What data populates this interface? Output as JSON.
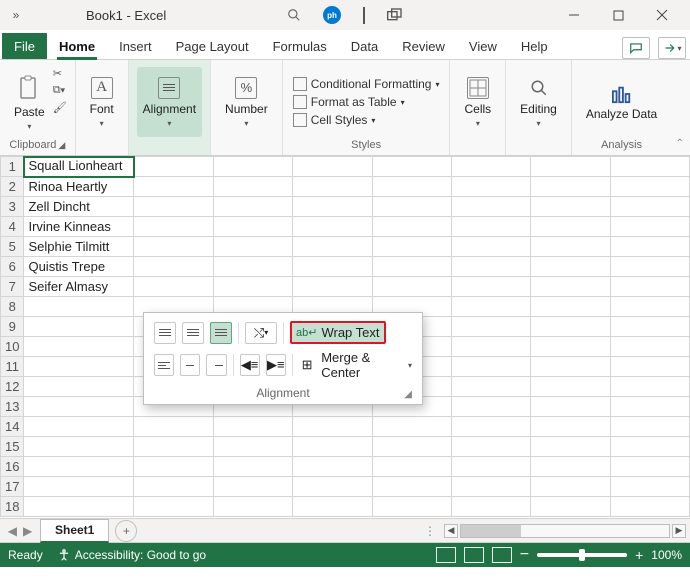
{
  "title": "Book1 - Excel",
  "tabs": {
    "file": "File",
    "home": "Home",
    "insert": "Insert",
    "page_layout": "Page Layout",
    "formulas": "Formulas",
    "data": "Data",
    "review": "Review",
    "view": "View",
    "help": "Help"
  },
  "ribbon": {
    "clipboard": {
      "paste": "Paste",
      "label": "Clipboard"
    },
    "font": {
      "label": "Font"
    },
    "alignment": {
      "label": "Alignment"
    },
    "number": {
      "label": "Number"
    },
    "styles": {
      "cond": "Conditional Formatting",
      "table": "Format as Table",
      "cell": "Cell Styles",
      "label": "Styles"
    },
    "cells": {
      "label": "Cells"
    },
    "editing": {
      "label": "Editing"
    },
    "analysis": {
      "btn": "Analyze Data",
      "label": "Analysis"
    }
  },
  "popup": {
    "wrap": "Wrap Text",
    "merge": "Merge & Center",
    "title": "Alignment"
  },
  "cells": {
    "a1": "Squall Lionheart",
    "a2": "Rinoa Heartly",
    "a3": "Zell Dincht",
    "a4": "Irvine Kinneas",
    "a5": "Selphie Tilmitt",
    "a6": "Quistis Trepe",
    "a7": "Seifer Almasy"
  },
  "row_headers": [
    "1",
    "2",
    "3",
    "4",
    "5",
    "6",
    "7",
    "8",
    "9",
    "10",
    "11",
    "12",
    "13",
    "14",
    "15",
    "16",
    "17",
    "18"
  ],
  "sheet": {
    "name": "Sheet1"
  },
  "status": {
    "ready": "Ready",
    "access": "Accessibility: Good to go",
    "zoom": "100%"
  }
}
